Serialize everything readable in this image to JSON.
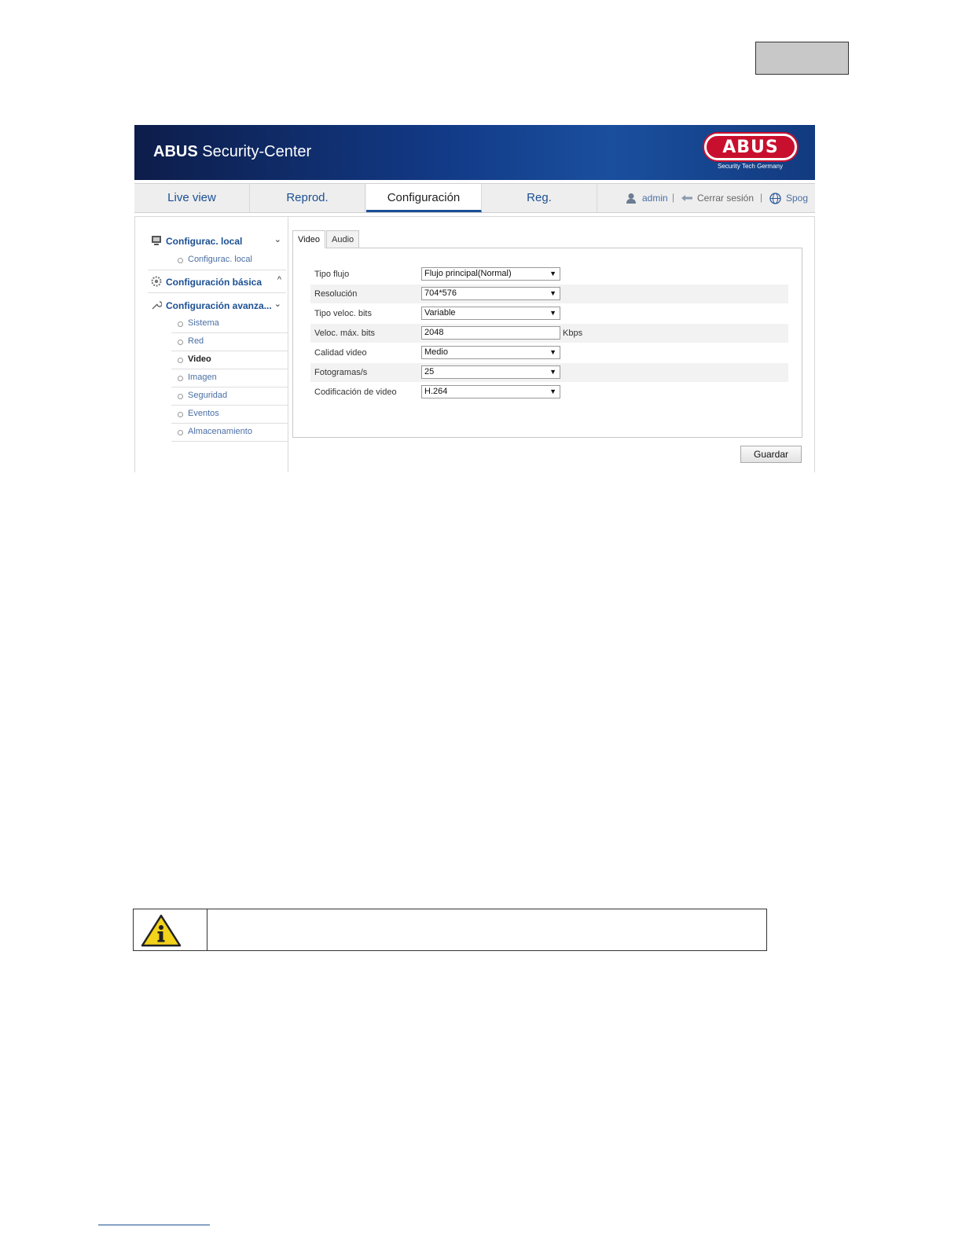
{
  "banner": {
    "brand": "ABUS",
    "title_rest": " Security-Center",
    "logo_text": "ABUS",
    "logo_subtitle": "Security Tech Germany"
  },
  "nav": {
    "tabs": [
      {
        "label": "Live view"
      },
      {
        "label": "Reprod."
      },
      {
        "label": "Configuración"
      },
      {
        "label": "Reg."
      }
    ],
    "active_tab": "Configuración",
    "user": "admin",
    "logout": "Cerrar sesión",
    "language": "Spog",
    "separator": "|"
  },
  "sidebar": {
    "sections": [
      {
        "label": "Configurac. local",
        "chevron": "⌄"
      },
      {
        "label": "Configuración básica",
        "chevron": "^"
      },
      {
        "label": "Configuración avanza...",
        "chevron": "⌄"
      }
    ],
    "local_sub": "Configurac. local",
    "items": [
      {
        "label": "Sistema"
      },
      {
        "label": "Red"
      },
      {
        "label": "Video"
      },
      {
        "label": "Imagen"
      },
      {
        "label": "Seguridad"
      },
      {
        "label": "Eventos"
      },
      {
        "label": "Almacenamiento"
      }
    ],
    "active_item": "Video"
  },
  "tabs": [
    {
      "label": "Video"
    },
    {
      "label": "Audio"
    }
  ],
  "form": {
    "rows": [
      {
        "label": "Tipo flujo",
        "value": "Flujo principal(Normal)",
        "control": "select"
      },
      {
        "label": "Resolución",
        "value": "704*576",
        "control": "select"
      },
      {
        "label": "Tipo veloc. bits",
        "value": "Variable",
        "control": "select"
      },
      {
        "label": "Veloc. máx. bits",
        "value": "2048",
        "control": "input",
        "unit": "Kbps"
      },
      {
        "label": "Calidad video",
        "value": "Medio",
        "control": "select"
      },
      {
        "label": "Fotogramas/s",
        "value": "25",
        "control": "select"
      },
      {
        "label": "Codificación de video",
        "value": "H.264",
        "control": "select"
      }
    ],
    "caret": "▼"
  },
  "save_button": "Guardar",
  "icons": {
    "user": "user-icon",
    "logout": "logout-icon",
    "language": "globe-icon",
    "warning": "info-warning-icon"
  },
  "colors": {
    "accent": "#1b4f93",
    "banner": "#123a86",
    "logo": "#c8102e"
  }
}
